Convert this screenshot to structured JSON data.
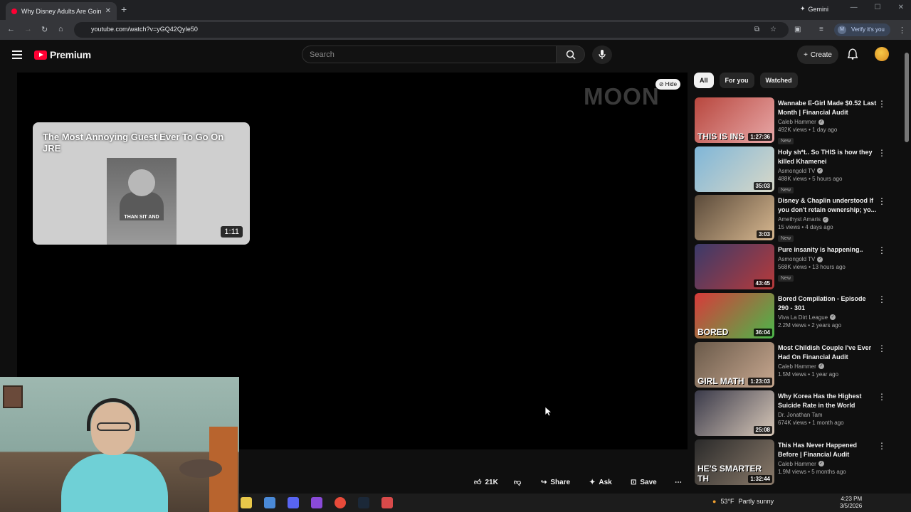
{
  "browser": {
    "tab_title": "Why Disney Adults Are Going I",
    "tab_close": "✕",
    "new_tab": "+",
    "gemini_label": "Gemini",
    "url": "youtube.com/watch?v=yGQ42QyIe50",
    "verify_label": "Verify it's you",
    "verify_avatar": "M"
  },
  "youtube": {
    "logo_word": "Premium",
    "search_placeholder": "Search",
    "create_label": "Create"
  },
  "player": {
    "watermark": "MOON",
    "hide_label": "Hide",
    "endcard": {
      "title": "The Most Annoying Guest Ever To Go On JRE",
      "caption": "THAN SIT AND",
      "duration": "1:11"
    }
  },
  "actions": {
    "likes": "21K",
    "share": "Share",
    "ask": "Ask",
    "save": "Save"
  },
  "chips": [
    "All",
    "For you",
    "Watched"
  ],
  "recommendations": [
    {
      "title": "Wannabe E-Girl Made $0.52 Last Month | Financial Audit",
      "channel": "Caleb Hammer",
      "verified": true,
      "stats": "492K views • 1 day ago",
      "badge": "New",
      "duration": "1:27:36",
      "overlay": "THIS IS INS",
      "colors": [
        "#b8473e",
        "#e8a8a8"
      ]
    },
    {
      "title": "Holy sh*t.. So THIS is how they killed Khamenei",
      "channel": "Asmongold TV",
      "verified": true,
      "stats": "488K views • 5 hours ago",
      "badge": "New",
      "duration": "35:03",
      "overlay": "",
      "colors": [
        "#7fb6d8",
        "#d8d8c8"
      ]
    },
    {
      "title": "Disney & Chaplin understood If you don't retain ownership; yo...",
      "channel": "Amethyst Amaris",
      "verified": true,
      "stats": "15 views • 4 days ago",
      "badge": "New",
      "duration": "3:03",
      "overlay": "",
      "colors": [
        "#5a4a3a",
        "#d8b890"
      ]
    },
    {
      "title": "Pure insanity is happening..",
      "channel": "Asmongold TV",
      "verified": true,
      "stats": "568K views • 13 hours ago",
      "badge": "New",
      "duration": "43:45",
      "overlay": "",
      "colors": [
        "#3a3a6a",
        "#b83a3a"
      ]
    },
    {
      "title": "Bored Compilation - Episode 290 - 301",
      "channel": "Viva La Dirt League",
      "verified": true,
      "stats": "2.2M views • 2 years ago",
      "badge": "",
      "duration": "36:04",
      "overlay": "BORED",
      "colors": [
        "#d83a3a",
        "#4ab84a"
      ]
    },
    {
      "title": "Most Childish Couple I've Ever Had On Financial Audit",
      "channel": "Caleb Hammer",
      "verified": true,
      "stats": "1.5M views • 1 year ago",
      "badge": "",
      "duration": "1:23:03",
      "overlay": "GIRL MATH",
      "colors": [
        "#6a5a4a",
        "#c8a890"
      ]
    },
    {
      "title": "Why Korea Has the Highest Suicide Rate in the World",
      "channel": "Dr. Jonathan Tam",
      "verified": false,
      "stats": "674K views • 1 month ago",
      "badge": "",
      "duration": "25:08",
      "overlay": "",
      "colors": [
        "#3a3a4a",
        "#d8c8b8"
      ]
    },
    {
      "title": "This Has Never Happened Before | Financial Audit",
      "channel": "Caleb Hammer",
      "verified": true,
      "stats": "1.9M views • 5 months ago",
      "badge": "",
      "duration": "1:32:44",
      "overlay": "HE'S SMARTER TH",
      "colors": [
        "#2a2a2a",
        "#8a7a6a"
      ]
    }
  ],
  "taskbar": {
    "temperature": "53°F",
    "weather": "Partly sunny",
    "time": "4:23 PM",
    "date": "3/5/2026",
    "app_colors": [
      "#e8c84a",
      "#4a8ad8",
      "#5865f2",
      "#8a4ad8",
      "#e84a3a",
      "#1b2838",
      "#d84a4a"
    ]
  }
}
